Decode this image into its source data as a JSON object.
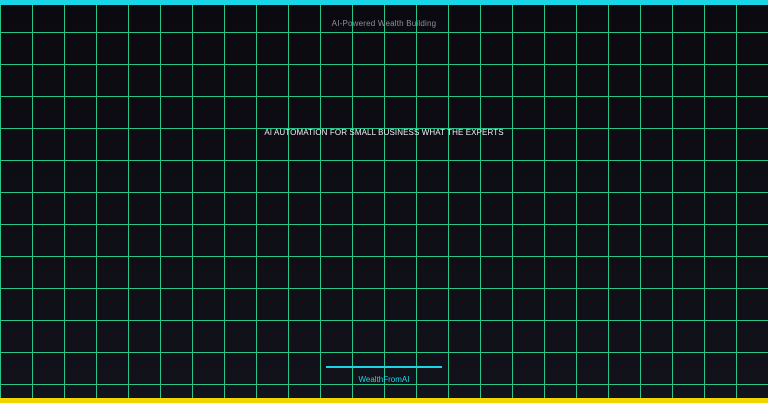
{
  "header": {
    "subtitle": "AI-Powered Wealth Building"
  },
  "main": {
    "headline": "AI AUTOMATION FOR SMALL BUSINESS WHAT THE EXPERTS"
  },
  "footer": {
    "brand": "WealthFromAI"
  },
  "colors": {
    "background": "#0d0c12",
    "grid": "#2ee59d",
    "accent_top": "#19d6e6",
    "accent_bottom": "#f2d400",
    "brand": "#19d6e6",
    "headline": "#f2f2f6",
    "subtitle": "#8d8f99"
  }
}
